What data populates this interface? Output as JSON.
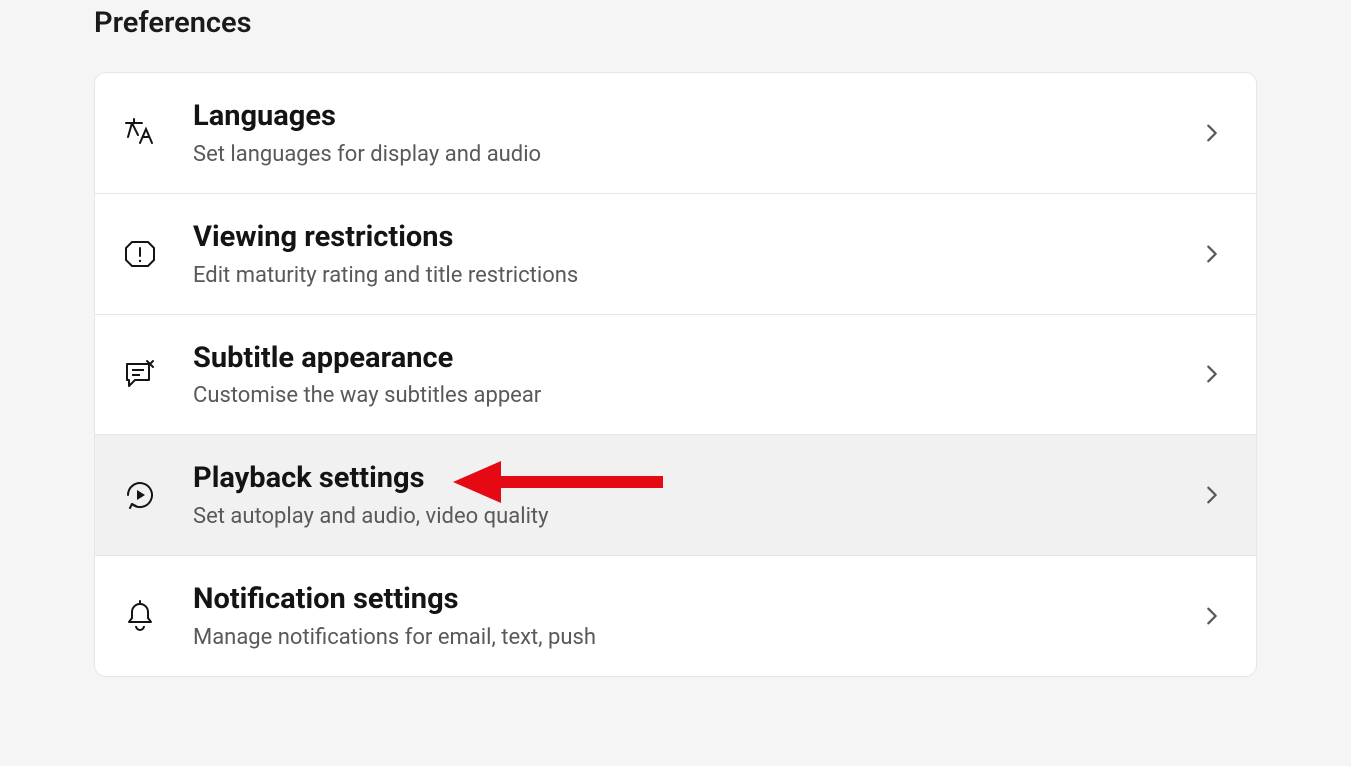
{
  "section": {
    "title": "Preferences",
    "items": [
      {
        "icon": "languages-icon",
        "title": "Languages",
        "subtitle": "Set languages for display and audio",
        "highlight": false
      },
      {
        "icon": "shield-icon",
        "title": "Viewing restrictions",
        "subtitle": "Edit maturity rating and title restrictions",
        "highlight": false
      },
      {
        "icon": "subtitle-icon",
        "title": "Subtitle appearance",
        "subtitle": "Customise the way subtitles appear",
        "highlight": false
      },
      {
        "icon": "playback-icon",
        "title": "Playback settings",
        "subtitle": "Set autoplay and audio, video quality",
        "highlight": true,
        "annotated": true
      },
      {
        "icon": "bell-icon",
        "title": "Notification settings",
        "subtitle": "Manage notifications for email, text, push",
        "highlight": false
      }
    ]
  },
  "annotation": {
    "color": "#e50914"
  }
}
